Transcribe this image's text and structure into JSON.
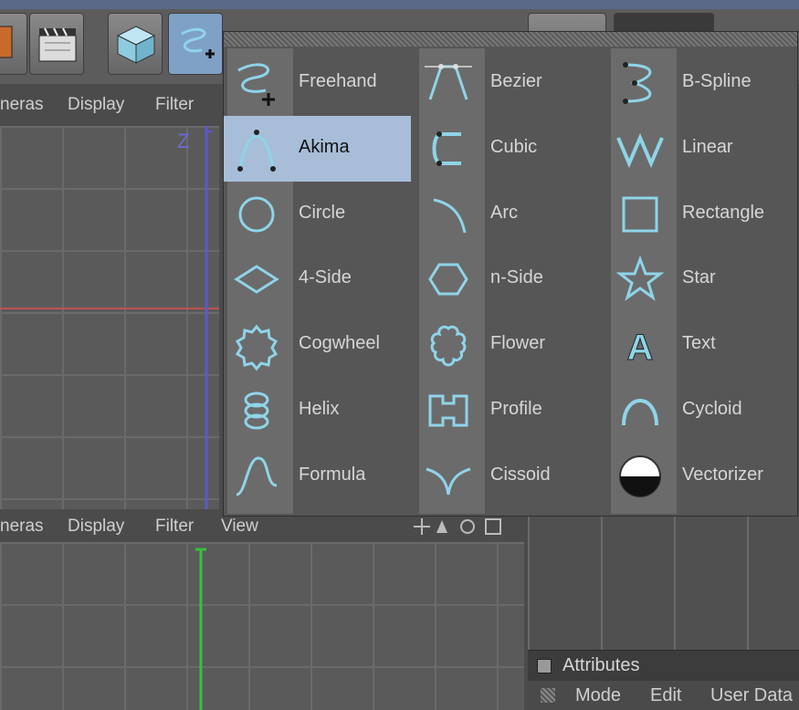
{
  "viewport_top_menu": {
    "cameras": "neras",
    "display": "Display",
    "filter": "Filter"
  },
  "viewport_bottom_menu": {
    "cameras": "neras",
    "display": "Display",
    "filter": "Filter",
    "view": "View"
  },
  "axis_label": "Z",
  "spline_menu": {
    "items": [
      {
        "label": "Freehand",
        "icon": "freehand-spline-icon"
      },
      {
        "label": "Akima",
        "icon": "akima-spline-icon",
        "selected": true
      },
      {
        "label": "Circle",
        "icon": "circle-spline-icon"
      },
      {
        "label": "4-Side",
        "icon": "four-side-icon"
      },
      {
        "label": "Cogwheel",
        "icon": "cogwheel-icon"
      },
      {
        "label": "Helix",
        "icon": "helix-icon"
      },
      {
        "label": "Formula",
        "icon": "formula-icon"
      },
      {
        "label": "Bezier",
        "icon": "bezier-spline-icon"
      },
      {
        "label": "Cubic",
        "icon": "cubic-spline-icon"
      },
      {
        "label": "Arc",
        "icon": "arc-icon"
      },
      {
        "label": "n-Side",
        "icon": "n-side-icon"
      },
      {
        "label": "Flower",
        "icon": "flower-icon"
      },
      {
        "label": "Profile",
        "icon": "profile-icon"
      },
      {
        "label": "Cissoid",
        "icon": "cissoid-icon"
      },
      {
        "label": "B-Spline",
        "icon": "b-spline-icon"
      },
      {
        "label": "Linear",
        "icon": "linear-spline-icon"
      },
      {
        "label": "Rectangle",
        "icon": "rectangle-icon"
      },
      {
        "label": "Star",
        "icon": "star-icon"
      },
      {
        "label": "Text",
        "icon": "text-icon"
      },
      {
        "label": "Cycloid",
        "icon": "cycloid-icon"
      },
      {
        "label": "Vectorizer",
        "icon": "vectorizer-icon"
      }
    ]
  },
  "attributes": {
    "title": "Attributes",
    "menu": {
      "mode": "Mode",
      "edit": "Edit",
      "user_data": "User Data"
    }
  },
  "colors": {
    "accent": "#a8bed8",
    "icon_cyan": "#8fd4e8",
    "axis_blue": "#5a5ad0",
    "axis_green": "#3ac03a",
    "axis_red": "#c05050"
  }
}
